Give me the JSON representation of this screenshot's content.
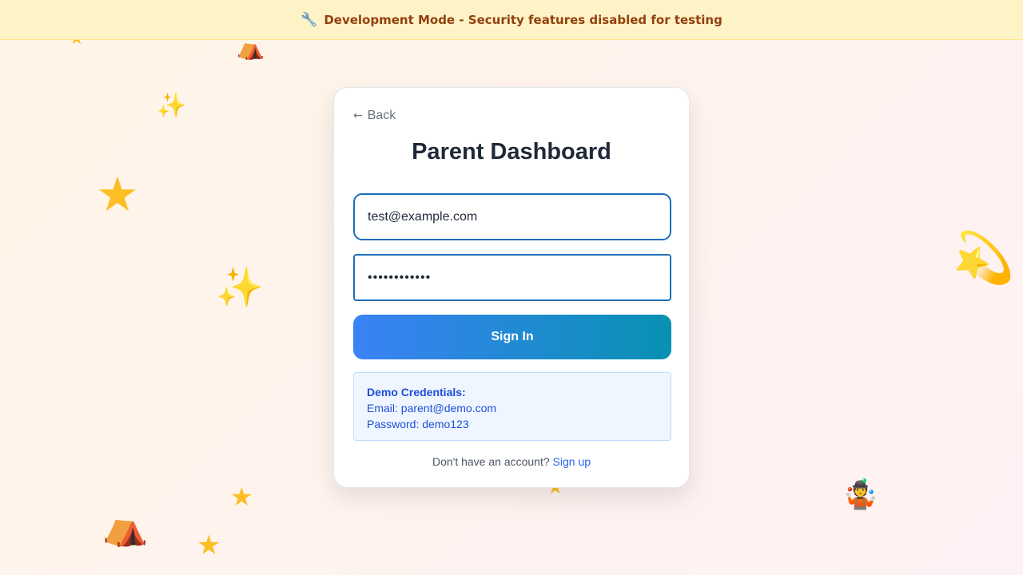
{
  "banner": {
    "icon": "wrench-icon",
    "text": "Development Mode - Security features disabled for testing"
  },
  "login": {
    "back_label": "Back",
    "title": "Parent Dashboard",
    "email_value": "test@example.com",
    "password_value": "testpassword",
    "signin_label": "Sign In",
    "demo": {
      "heading": "Demo Credentials:",
      "email_line": "Email: parent@demo.com",
      "password_line": "Password: demo123"
    },
    "signup_prompt": "Don't have an account?",
    "signup_link": "Sign up"
  },
  "colors": {
    "accent_start": "#3b82f6",
    "accent_end": "#0891b2",
    "banner_bg": "#fef3c7",
    "banner_text": "#92400e",
    "demo_text": "#1d4ed8"
  },
  "decorations": [
    "star-icon",
    "sparkles-icon",
    "circus-tent-icon",
    "dizzy-icon",
    "juggler-icon"
  ]
}
